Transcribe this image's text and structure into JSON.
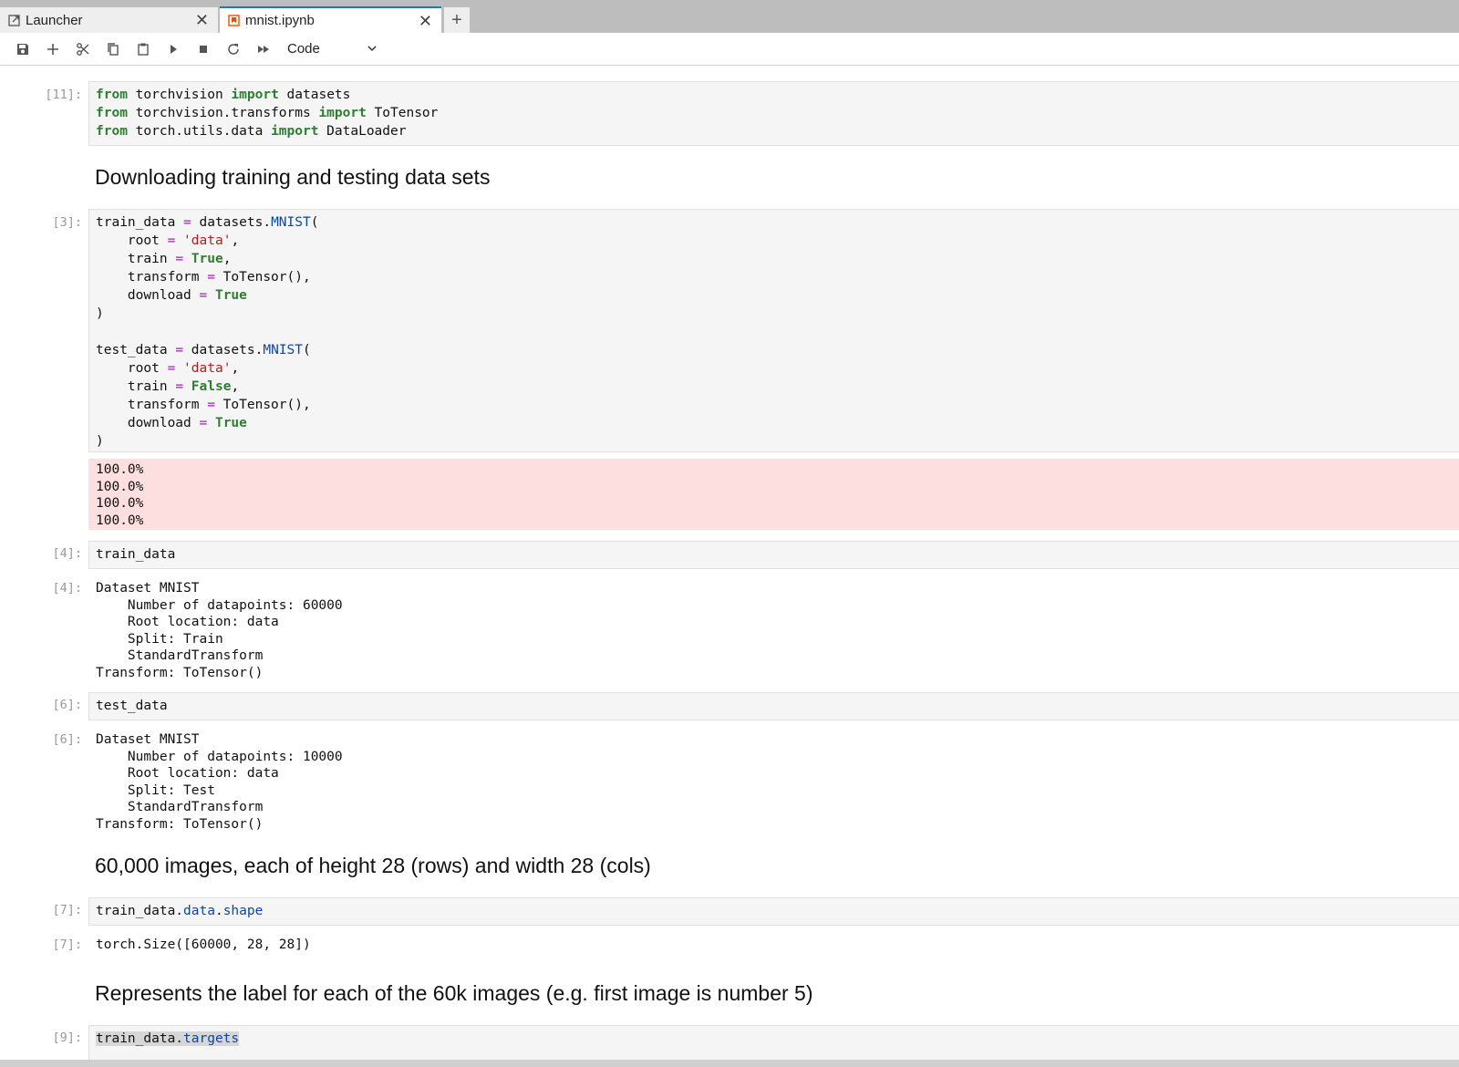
{
  "tabs": [
    {
      "label": "Launcher",
      "icon": "launcher-icon"
    },
    {
      "label": "mnist.ipynb",
      "icon": "notebook-icon"
    }
  ],
  "toolbar": {
    "cell_type": "Code",
    "buttons": [
      "save-icon",
      "add-icon",
      "cut-icon",
      "copy-icon",
      "paste-icon",
      "run-icon",
      "stop-icon",
      "restart-icon",
      "fast-forward-icon"
    ]
  },
  "cells": {
    "c1": {
      "prompt": "[11]:",
      "lines": [
        [
          {
            "t": "from",
            "c": "kw"
          },
          {
            "t": " torchvision "
          },
          {
            "t": "import",
            "c": "kw"
          },
          {
            "t": " datasets"
          }
        ],
        [
          {
            "t": "from",
            "c": "kw"
          },
          {
            "t": " torchvision.transforms "
          },
          {
            "t": "import",
            "c": "kw"
          },
          {
            "t": " ToTensor"
          }
        ],
        [
          {
            "t": "from",
            "c": "kw"
          },
          {
            "t": " torch.utils.data "
          },
          {
            "t": "import",
            "c": "kw"
          },
          {
            "t": " DataLoader"
          }
        ]
      ]
    },
    "md1": "Downloading training and testing data sets",
    "c2": {
      "prompt": "[3]:",
      "lines": [
        [
          {
            "t": "train_data "
          },
          {
            "t": "=",
            "c": "op"
          },
          {
            "t": " datasets."
          },
          {
            "t": "MNIST",
            "c": "attr"
          },
          {
            "t": "("
          }
        ],
        [
          {
            "t": "    root "
          },
          {
            "t": "=",
            "c": "op"
          },
          {
            "t": " "
          },
          {
            "t": "'data'",
            "c": "str"
          },
          {
            "t": ","
          }
        ],
        [
          {
            "t": "    train "
          },
          {
            "t": "=",
            "c": "op"
          },
          {
            "t": " "
          },
          {
            "t": "True",
            "c": "kw"
          },
          {
            "t": ","
          }
        ],
        [
          {
            "t": "    transform "
          },
          {
            "t": "=",
            "c": "op"
          },
          {
            "t": " ToTensor(),"
          }
        ],
        [
          {
            "t": "    download "
          },
          {
            "t": "=",
            "c": "op"
          },
          {
            "t": " "
          },
          {
            "t": "True",
            "c": "kw"
          }
        ],
        [
          {
            "t": ")"
          }
        ],
        [
          {
            "t": ""
          }
        ],
        [
          {
            "t": "test_data "
          },
          {
            "t": "=",
            "c": "op"
          },
          {
            "t": " datasets."
          },
          {
            "t": "MNIST",
            "c": "attr"
          },
          {
            "t": "("
          }
        ],
        [
          {
            "t": "    root "
          },
          {
            "t": "=",
            "c": "op"
          },
          {
            "t": " "
          },
          {
            "t": "'data'",
            "c": "str"
          },
          {
            "t": ","
          }
        ],
        [
          {
            "t": "    train "
          },
          {
            "t": "=",
            "c": "op"
          },
          {
            "t": " "
          },
          {
            "t": "False",
            "c": "kw"
          },
          {
            "t": ","
          }
        ],
        [
          {
            "t": "    transform "
          },
          {
            "t": "=",
            "c": "op"
          },
          {
            "t": " ToTensor(),"
          }
        ],
        [
          {
            "t": "    download "
          },
          {
            "t": "=",
            "c": "op"
          },
          {
            "t": " "
          },
          {
            "t": "True",
            "c": "kw"
          }
        ],
        [
          {
            "t": ")"
          }
        ]
      ],
      "stderr": "100.0%\n100.0%\n100.0%\n100.0%"
    },
    "c3": {
      "prompt": "[4]:",
      "lines": [
        [
          {
            "t": "train_data"
          }
        ]
      ],
      "out_prompt": "[4]:",
      "output": "Dataset MNIST\n    Number of datapoints: 60000\n    Root location: data\n    Split: Train\n    StandardTransform\nTransform: ToTensor()"
    },
    "c4": {
      "prompt": "[6]:",
      "lines": [
        [
          {
            "t": "test_data"
          }
        ]
      ],
      "out_prompt": "[6]:",
      "output": "Dataset MNIST\n    Number of datapoints: 10000\n    Root location: data\n    Split: Test\n    StandardTransform\nTransform: ToTensor()"
    },
    "md2": "60,000 images, each of height 28 (rows) and width 28 (cols)",
    "c5": {
      "prompt": "[7]:",
      "lines": [
        [
          {
            "t": "train_data."
          },
          {
            "t": "data",
            "c": "attr"
          },
          {
            "t": "."
          },
          {
            "t": "shape",
            "c": "attr"
          }
        ]
      ],
      "out_prompt": "[7]:",
      "output": "torch.Size([60000, 28, 28])"
    },
    "md3": "Represents the label for each of the 60k images (e.g. first image is number 5)",
    "c6": {
      "prompt": "[9]:",
      "lines": [
        [
          {
            "t": "train_data.",
            "c": "hl"
          },
          {
            "t": "targets",
            "c": "attr hl"
          }
        ]
      ]
    }
  }
}
